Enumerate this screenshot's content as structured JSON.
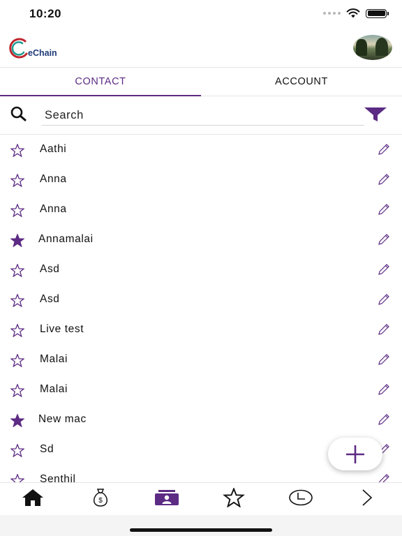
{
  "status_bar": {
    "time": "10:20"
  },
  "header": {
    "logo_text": "eChain"
  },
  "tabs": [
    {
      "label": "CONTACT",
      "active": true
    },
    {
      "label": "ACCOUNT",
      "active": false
    }
  ],
  "search": {
    "placeholder": "Search"
  },
  "contacts": [
    {
      "name": "Aathi",
      "starred": false
    },
    {
      "name": "Anna",
      "starred": false
    },
    {
      "name": "Anna",
      "starred": false
    },
    {
      "name": "Annamalai",
      "starred": true
    },
    {
      "name": "Asd",
      "starred": false
    },
    {
      "name": "Asd",
      "starred": false
    },
    {
      "name": "Live test",
      "starred": false
    },
    {
      "name": "Malai",
      "starred": false
    },
    {
      "name": "Malai",
      "starred": false
    },
    {
      "name": "New mac",
      "starred": true
    },
    {
      "name": "Sd",
      "starred": false
    },
    {
      "name": "Senthil",
      "starred": false
    }
  ],
  "bottom_nav": [
    {
      "icon": "home-icon"
    },
    {
      "icon": "money-bag-icon"
    },
    {
      "icon": "contacts-icon",
      "active": true
    },
    {
      "icon": "star-icon"
    },
    {
      "icon": "clock-icon"
    },
    {
      "icon": "chevron-right-icon"
    }
  ],
  "colors": {
    "accent": "#5c2b84",
    "text": "#111111"
  }
}
